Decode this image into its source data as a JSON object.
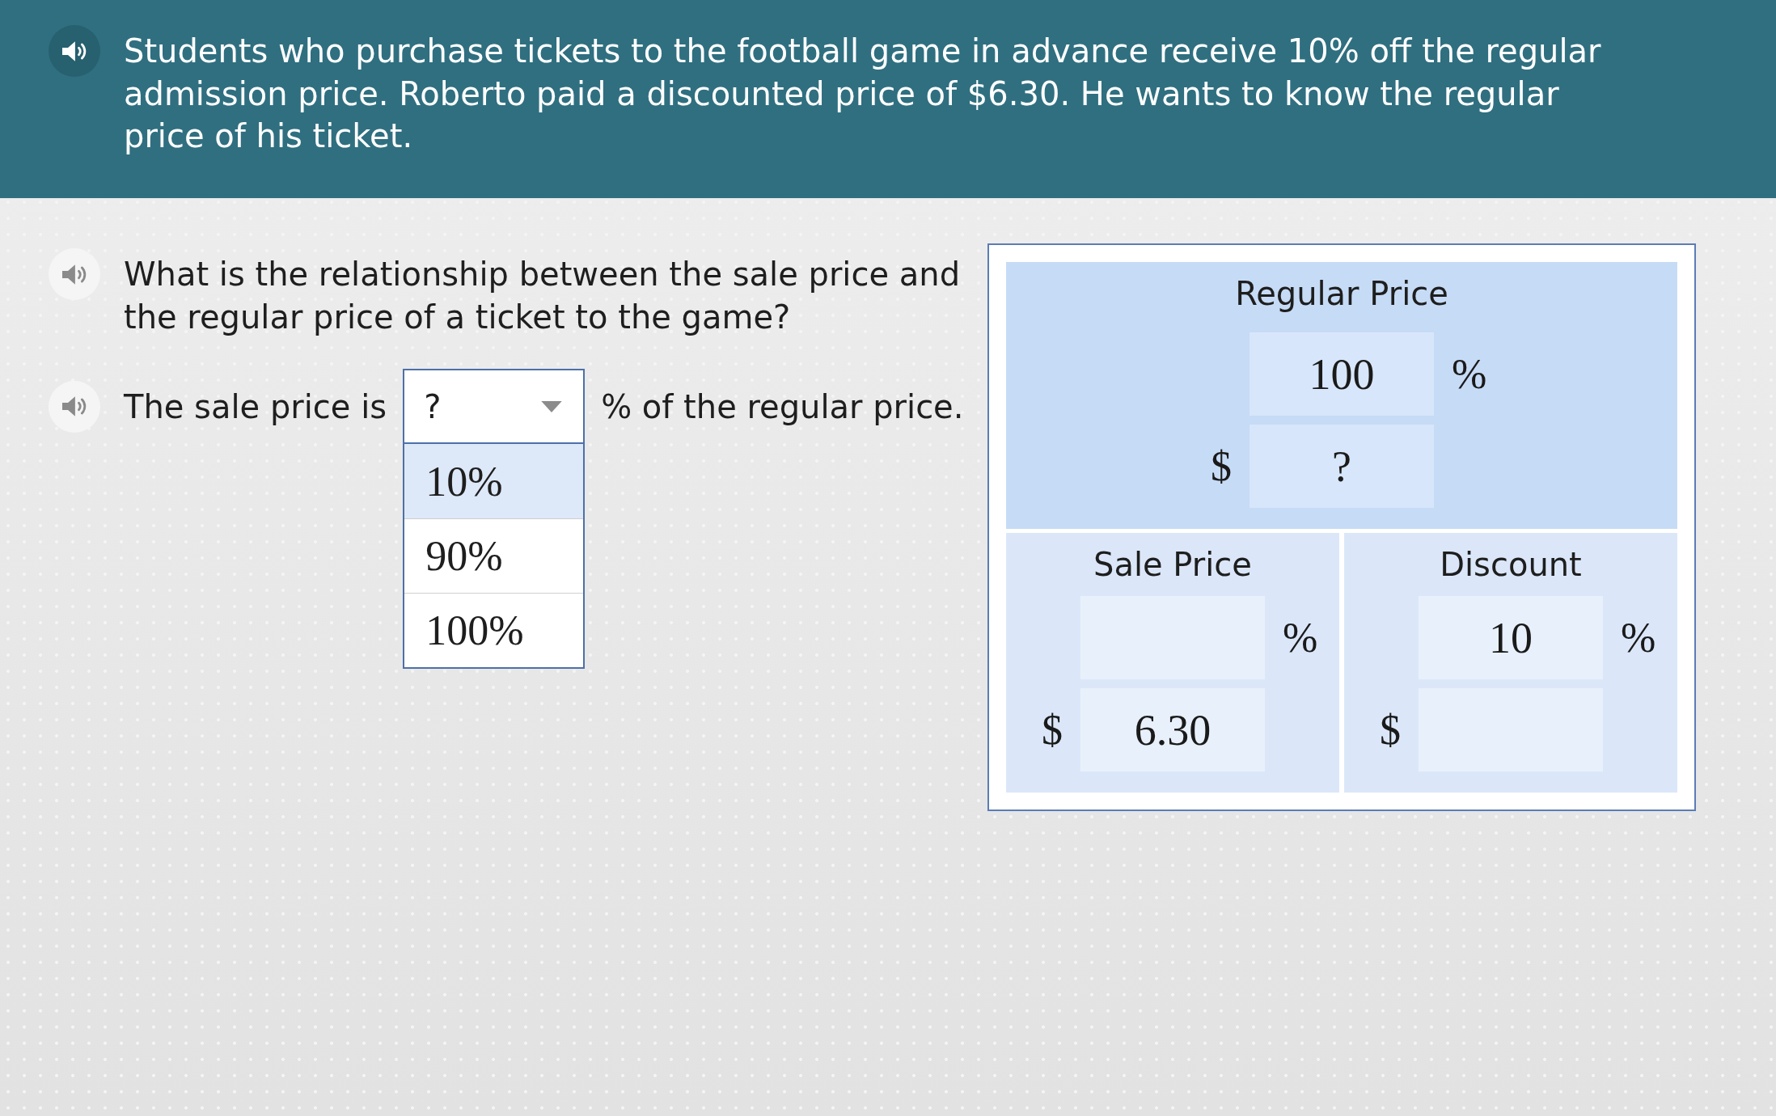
{
  "problem": {
    "text": "Students who purchase tickets to the football game in advance receive 10% off the regular admission price. Roberto paid a discounted price of $6.30. He wants to know the regular price of his ticket."
  },
  "questions": [
    {
      "kind": "statement",
      "text": "What is the relationship between the sale price and the regular price of a ticket to the game?"
    },
    {
      "kind": "dropdown_sentence",
      "before": "The sale price is",
      "dropdown": {
        "value": "?",
        "expanded": true,
        "options": [
          {
            "label": "10%",
            "highlighted": true
          },
          {
            "label": "90%",
            "highlighted": false
          },
          {
            "label": "100%",
            "highlighted": false
          }
        ]
      },
      "after": "% of the regular price."
    }
  ],
  "diagram": {
    "panels": [
      {
        "kind": "whole",
        "title": "Regular Price",
        "rows": [
          {
            "kind": "suffix",
            "value": "100",
            "unit": "%"
          },
          {
            "kind": "prefix",
            "value": "?",
            "unit": "$"
          }
        ]
      },
      {
        "kind": "part",
        "title": "Sale Price",
        "rows": [
          {
            "kind": "suffix",
            "unit": "%"
          },
          {
            "kind": "prefix",
            "value": "6.30",
            "unit": "$"
          }
        ]
      },
      {
        "kind": "part",
        "title": "Discount",
        "rows": [
          {
            "kind": "suffix",
            "value": "10",
            "unit": "%"
          },
          {
            "kind": "prefix",
            "unit": "$"
          }
        ]
      }
    ]
  }
}
